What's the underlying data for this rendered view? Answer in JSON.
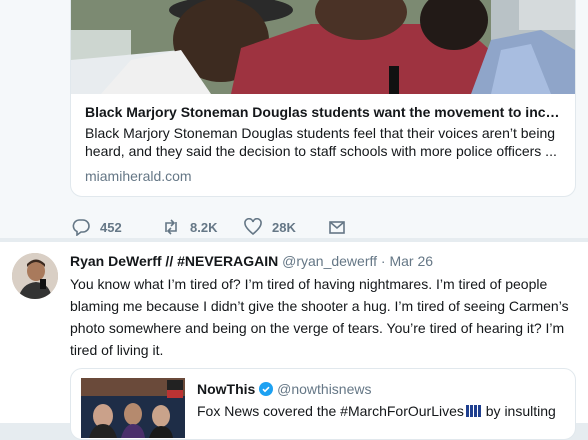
{
  "card": {
    "title": "Black Marjory Stoneman Douglas students want the movement to inc…",
    "description": "Black Marjory Stoneman Douglas students feel that their voices aren’t being heard, and they said the decision to staff schools with more police officers ...",
    "domain": "miamiherald.com"
  },
  "actions": {
    "replies": "452",
    "retweets": "8.2K",
    "likes": "28K"
  },
  "tweet": {
    "name": "Ryan DeWerff // #NEVERAGAIN",
    "handle": "@ryan_dewerff",
    "separator": "·",
    "date": "Mar 26",
    "text": "You know what I’m tired of? I’m tired of having nightmares. I’m tired of people blaming me because I didn’t give the shooter a hug. I’m tired of seeing Carmen’s photo somewhere and being on the verge of tears. You’re tired of hearing it? I’m tired of living it."
  },
  "quote": {
    "name": "NowThis",
    "handle": "@nowthisnews",
    "text": "Fox News covered the #MarchForOurLives",
    "text_end": " by insulting"
  },
  "colors": {
    "link": "#1da1f2",
    "verified": "#1da1f2",
    "muted": "#657786"
  },
  "icons": [
    "reply-icon",
    "retweet-icon",
    "like-icon",
    "message-icon",
    "verified-icon"
  ]
}
